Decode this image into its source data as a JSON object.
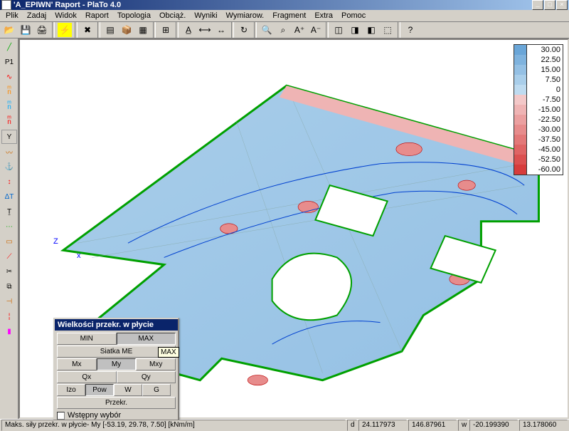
{
  "window": {
    "title": "'A_EPIWN' Raport  - PlaTo 4.0"
  },
  "menu": [
    "Plik",
    "Zadaj",
    "Widok",
    "Raport",
    "Topologia",
    "Obciąż.",
    "Wyniki",
    "Wymiarow.",
    "Fragment",
    "Extra",
    "Pomoc"
  ],
  "toolbar_icons": [
    "open",
    "save",
    "print-setup",
    "sep",
    "highlight",
    "sep",
    "delete",
    "sep",
    "layers",
    "box",
    "grid",
    "sep",
    "dim",
    "sep",
    "align-l",
    "align-c",
    "align-r",
    "sep",
    "refresh",
    "sep",
    "zoom",
    "zoom-win",
    "text-plus",
    "text-minus",
    "sep",
    "3d-iso",
    "3d-top",
    "3d-side",
    "cube",
    "sep",
    "help"
  ],
  "leftbar_icons": [
    "line",
    "p1",
    "polyline-r",
    "polyline-n",
    "polyline-n2",
    "polyline-y",
    "Y-box",
    "spline",
    "anchor",
    "move",
    "dim-t",
    "text",
    "dashed",
    "rect",
    "cut",
    "scissors",
    "combine",
    "end",
    "pipe",
    "marker"
  ],
  "legend": [
    {
      "color": "#6aa6d8",
      "label": "30.00"
    },
    {
      "color": "#7fb3de",
      "label": "22.50"
    },
    {
      "color": "#94c0e4",
      "label": "15.00"
    },
    {
      "color": "#a9ceea",
      "label": "7.50"
    },
    {
      "color": "#bedbf0",
      "label": "0"
    },
    {
      "color": "#f3c8c8",
      "label": "-7.50"
    },
    {
      "color": "#efb4b4",
      "label": "-15.00"
    },
    {
      "color": "#eba0a0",
      "label": "-22.50"
    },
    {
      "color": "#e78c8c",
      "label": "-30.00"
    },
    {
      "color": "#e37878",
      "label": "-37.50"
    },
    {
      "color": "#df6464",
      "label": "-45.00"
    },
    {
      "color": "#db5050",
      "label": "-52.50"
    },
    {
      "color": "#d73c3c",
      "label": "-60.00"
    }
  ],
  "panel": {
    "title": "Wielkości przekr. w płycie",
    "min": "MIN",
    "max": "MAX",
    "siatka": "Siatka ME",
    "mx": "Mx",
    "my": "My",
    "mxy": "Mxy",
    "qx": "Qx",
    "qy": "Qy",
    "izo": "Izo",
    "pow": "Pow",
    "w": "W",
    "g": "G",
    "przekr": "Przekr.",
    "tooltip": "MAX",
    "wstepny": "Wstępny wybór"
  },
  "axes": {
    "x": "x",
    "z": "Z"
  },
  "status": {
    "main": "Maks. siły przekr. w płycie- My [-53.19, 29.78,  7.50] [kNm/m]",
    "d": "d",
    "x": "24.117973",
    "y": "146.87961",
    "w": "w",
    "wx": "-20.199390",
    "wy": "13.178060"
  }
}
